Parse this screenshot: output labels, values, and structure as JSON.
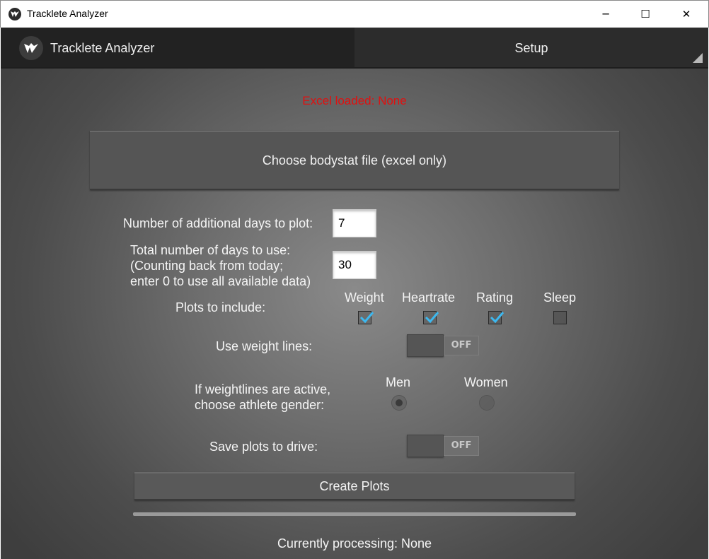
{
  "window": {
    "title": "Tracklete Analyzer",
    "controls": {
      "minimize": "─",
      "maximize": "☐",
      "close": "✕"
    }
  },
  "actionbar": {
    "title": "Tracklete Analyzer",
    "setup_label": "Setup"
  },
  "status": {
    "excel_loaded": "Excel loaded: None",
    "currently_processing": "Currently processing: None"
  },
  "choose_file_button": "Choose bodystat file (excel only)",
  "additional_days": {
    "label": "Number of additional days to plot:",
    "value": "7"
  },
  "total_days": {
    "label_line1": "Total number of days to use:",
    "label_line2": "(Counting back from today;",
    "label_line3": "enter 0 to use all available data)",
    "value": "30"
  },
  "plots": {
    "label": "Plots to include:",
    "options": [
      {
        "label": "Weight",
        "checked": true
      },
      {
        "label": "Heartrate",
        "checked": true
      },
      {
        "label": "Rating",
        "checked": true
      },
      {
        "label": "Sleep",
        "checked": false
      }
    ]
  },
  "weight_lines": {
    "label": "Use weight lines:",
    "state": "OFF"
  },
  "gender": {
    "label_line1": "If weightlines are active,",
    "label_line2": "choose athlete gender:",
    "options": [
      {
        "label": "Men",
        "selected": true
      },
      {
        "label": "Women",
        "selected": false
      }
    ]
  },
  "save_plots": {
    "label": "Save plots to drive:",
    "state": "OFF"
  },
  "create_button": "Create Plots",
  "progress": 0,
  "colors": {
    "accent": "#3db8ef",
    "error": "#e01010",
    "actionbar": "#222222"
  }
}
